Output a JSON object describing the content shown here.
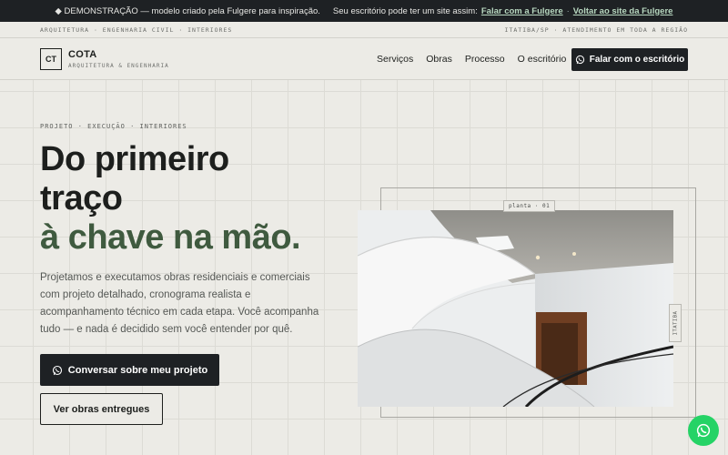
{
  "topbar": {
    "prefix": "◆ DEMONSTRAÇÃO — modelo criado pela Fulgere para inspiração.",
    "middle": "Seu escritório pode ter um site assim:",
    "link1": "Falar com a Fulgere",
    "dot": "·",
    "link2": "Voltar ao site da Fulgere"
  },
  "infobar": {
    "left": "ARQUITETURA · ENGENHARIA CIVIL · INTERIORES",
    "right": "ITATIBA/SP · ATENDIMENTO EM TODA A REGIÃO"
  },
  "header": {
    "logo_mark": "CT",
    "brand_name": "COTA",
    "brand_sub": "ARQUITETURA & ENGENHARIA",
    "nav": [
      "Serviços",
      "Obras",
      "Processo",
      "O escritório"
    ],
    "cta": "Falar com o escritório"
  },
  "hero": {
    "eyebrow": "PROJETO · EXECUÇÃO · INTERIORES",
    "title_line1": "Do primeiro",
    "title_line2": "traço",
    "title_line3": "à chave na mão.",
    "lede": "Projetamos e executamos obras residenciais e comerciais com projeto detalhado, cronograma realista e acompanhamento técnico em cada etapa. Você acompanha tudo — e nada é decidido sem você entender por quê.",
    "cta_primary": "Conversar sobre meu projeto",
    "cta_secondary": "Ver obras entregues",
    "photo_tag": "planta · 01",
    "side_tag": "ITATIBA"
  },
  "colors": {
    "background": "#ecebe6",
    "dark": "#1e2124",
    "accent_green": "#3f5a3f",
    "whatsapp": "#25d366"
  },
  "icons": {
    "whatsapp": "whatsapp-icon"
  }
}
